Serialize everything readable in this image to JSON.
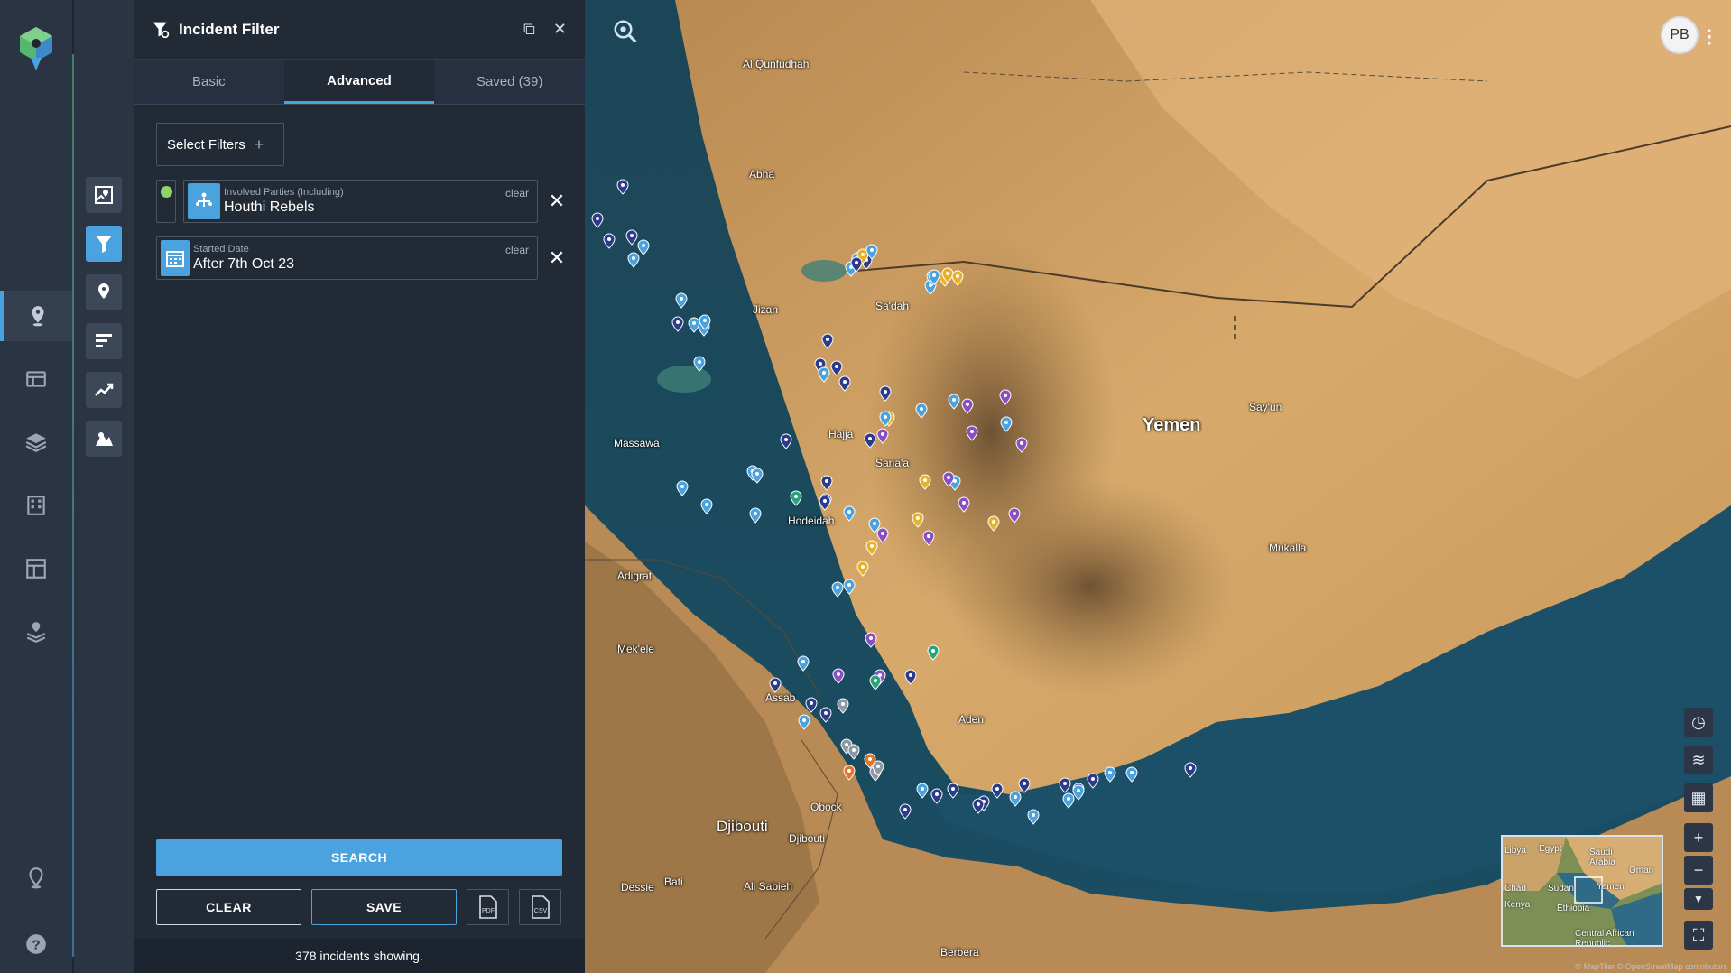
{
  "panel": {
    "title": "Incident Filter",
    "tabs": [
      {
        "label": "Basic"
      },
      {
        "label": "Advanced"
      },
      {
        "label": "Saved (39)"
      }
    ],
    "select_filters_label": "Select Filters",
    "filters": [
      {
        "label": "Involved Parties (Including)",
        "value": "Houthi Rebels",
        "clear": "clear",
        "enabled": true,
        "icon": "people-icon"
      },
      {
        "label": "Started Date",
        "value": "After 7th Oct 23",
        "clear": "clear",
        "icon": "calendar-icon"
      }
    ],
    "search_label": "SEARCH",
    "clear_label": "CLEAR",
    "save_label": "SAVE",
    "status": "378 incidents showing."
  },
  "rail": {
    "items": [
      "map-pin-icon",
      "table-icon",
      "layers-icon",
      "building-icon",
      "layout-icon",
      "stack-icon",
      "location-icon",
      "help-icon"
    ]
  },
  "tools": {
    "items": [
      "map-area-icon",
      "filter-icon",
      "pin-icon",
      "bars-icon",
      "trend-icon",
      "heatmap-icon"
    ]
  },
  "map": {
    "user_initials": "PB",
    "places": [
      {
        "name": "Al Qunfudhah"
      },
      {
        "name": "Abha"
      },
      {
        "name": "Jizan"
      },
      {
        "name": "Sa'dah"
      },
      {
        "name": "Massawa"
      },
      {
        "name": "Hajja"
      },
      {
        "name": "Sana'a"
      },
      {
        "name": "Yemen"
      },
      {
        "name": "Say'un"
      },
      {
        "name": "Mukalla"
      },
      {
        "name": "Adigrat"
      },
      {
        "name": "Mek'ele"
      },
      {
        "name": "Assab"
      },
      {
        "name": "Aden"
      },
      {
        "name": "Obock"
      },
      {
        "name": "Djibouti"
      },
      {
        "name": "Djibouti"
      },
      {
        "name": "Dessie"
      },
      {
        "name": "Bati"
      },
      {
        "name": "Ali Sabieh"
      },
      {
        "name": "Berbera"
      },
      {
        "name": "Hodeidah"
      }
    ],
    "minimap_labels": [
      "Egypt",
      "Saudi Arabia",
      "Oman",
      "Yemen",
      "Sudan",
      "Ethiopia",
      "Kenya",
      "Central African Republic",
      "Chad",
      "Libya"
    ],
    "attribution": "© MapTiler © OpenStreetMap contributors",
    "colors": {
      "accent": "#4aa3df",
      "sea": "#1d4a5c",
      "land": "#c99a5c"
    }
  }
}
